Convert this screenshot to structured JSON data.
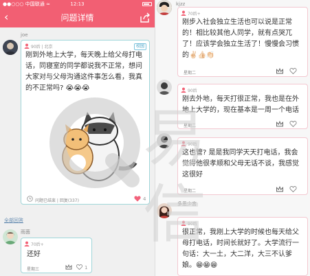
{
  "statusbar": {
    "carrier": "●●○○○ 中国联通 ≈",
    "time": "12:13"
  },
  "navbar": {
    "title": "问题详情",
    "back_symbol": "‹"
  },
  "question": {
    "author": "joe",
    "tag": "90后 | 北京",
    "badge": "校园",
    "text_lines": [
      "刚到外地上大学，每天晚上给父母打电",
      "话，同寝室的同学都说我不正常，想问",
      "大家对与父母沟通这件事怎么看，我真",
      "的不正常吗? 😭😭😭"
    ],
    "footer": "问题已结束 | 回复(337)",
    "likes": "4"
  },
  "all_answers_label": "全部回答",
  "left_answer": {
    "author": "雨茵",
    "tag": "70后+",
    "text": "还好",
    "time": "星期三",
    "likes": "1"
  },
  "right_answers": [
    {
      "author": "kjzz",
      "tag": "70后+",
      "lines": [
        "刚步入社会独立生活也可以说是正常",
        "的！相比较其他人同学，就有点哭兀",
        "了！应该学会独立生活了！慢慢会习惯",
        "的✌🏻👍🏻👏🏻"
      ],
      "time": "星期二",
      "likes": ""
    },
    {
      "author": "",
      "tag": "90后",
      "lines": [
        "刚去外地，每天打很正常，我也是在外",
        "地上大学的，现在基本是一周一个电话"
      ],
      "time": "星期二",
      "likes": ""
    },
    {
      "author": "",
      "tag": "90后",
      "lines": [
        "这也管? 是是我同学天天打电话，我会",
        "觉得他很孝顺和父母无话不谈，我感觉",
        "这很好"
      ],
      "time": "星期二",
      "likes": ""
    },
    {
      "author": "多思少言",
      "tag": "90后",
      "lines": [
        "很正常，我刚上大学的时候也每天给父",
        "母打电话，时间长就好了。大学流行一",
        "句话：大一土，大二洋，大三不认爹",
        "娘。😁😁😁"
      ],
      "time": "星期二",
      "likes": ""
    }
  ],
  "watermark": "易信",
  "colors": {
    "accent": "#f25f73",
    "teal_border": "#9fd6d9",
    "pink_border": "#f3c7d0"
  }
}
